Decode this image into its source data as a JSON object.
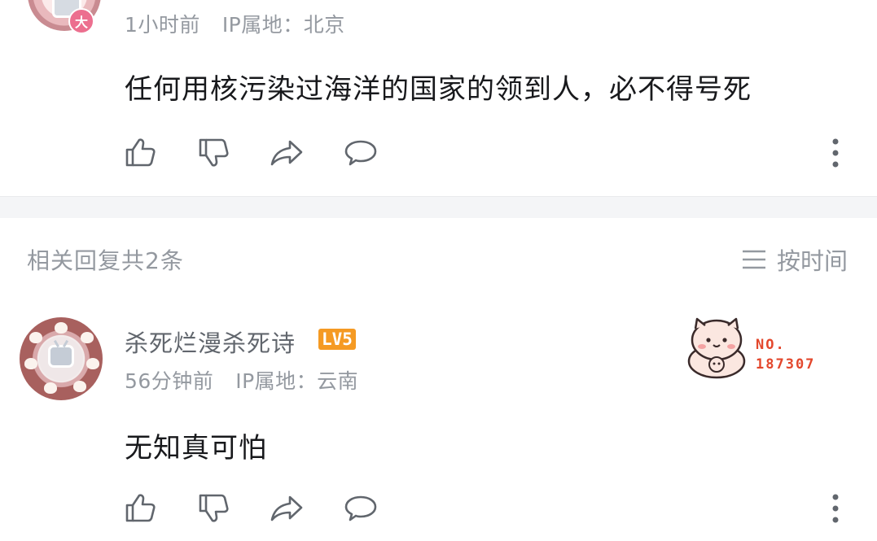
{
  "first_comment": {
    "badge_char": "大",
    "time": "1小时前",
    "ip": "IP属地：北京",
    "text": "任何用核污染过海洋的国家的领到人，必不得号死"
  },
  "replies_header": {
    "title": "相关回复共2条",
    "sort_label": "按时间"
  },
  "reply": {
    "username": "杀死烂漫杀死诗",
    "level": "LV5",
    "time": "56分钟前",
    "ip": "IP属地：云南",
    "text": "无知真可怕",
    "fan_badge": {
      "prefix": "NO.",
      "number": "187307"
    }
  },
  "colors": {
    "level_badge": "#f59a23",
    "fan_number": "#e3472c",
    "meta_text": "#9499a0",
    "divider": "#f4f5f7"
  },
  "icons": [
    "thumbs-up-icon",
    "thumbs-down-icon",
    "share-icon",
    "comment-icon",
    "more-vertical-icon",
    "menu-lines-icon"
  ]
}
